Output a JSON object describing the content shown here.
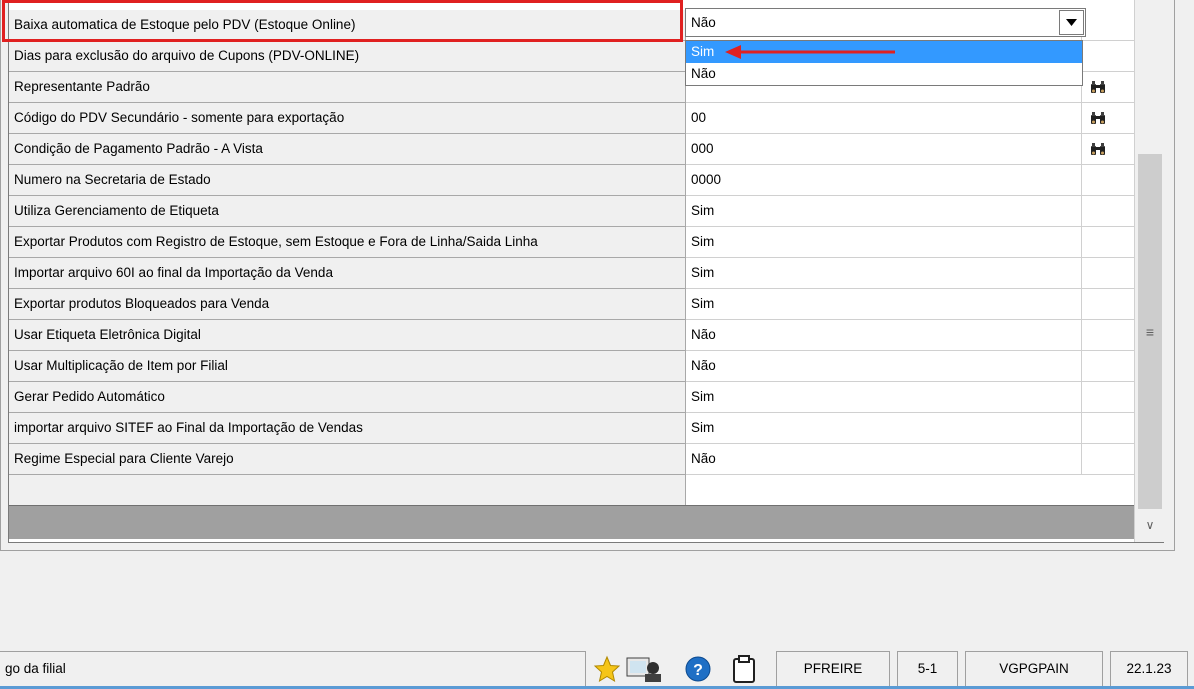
{
  "grid": {
    "rows": [
      {
        "label": "Baixa automatica de Estoque pelo PDV (Estoque Online)",
        "value": "",
        "lookup": false
      },
      {
        "label": "Dias para exclusão do arquivo de Cupons (PDV-ONLINE)",
        "value": "",
        "lookup": false
      },
      {
        "label": "Representante Padrão",
        "value": "",
        "lookup": true
      },
      {
        "label": "Código do PDV Secundário - somente para exportação",
        "value": "00",
        "lookup": true
      },
      {
        "label": "Condição de Pagamento Padrão - A Vista",
        "value": "000",
        "lookup": true
      },
      {
        "label": "Numero na Secretaria de Estado",
        "value": "0000",
        "lookup": false
      },
      {
        "label": "Utiliza Gerenciamento de Etiqueta",
        "value": "Sim",
        "lookup": false
      },
      {
        "label": "Exportar Produtos com Registro de Estoque, sem Estoque e Fora de Linha/Saida Linha",
        "value": "Sim",
        "lookup": false
      },
      {
        "label": "Importar arquivo 60I ao final da Importação da Venda",
        "value": "Sim",
        "lookup": false
      },
      {
        "label": "Exportar produtos Bloqueados para Venda",
        "value": "Sim",
        "lookup": false
      },
      {
        "label": "Usar Etiqueta Eletrônica Digital",
        "value": "Não",
        "lookup": false
      },
      {
        "label": "Usar Multiplicação de Item por Filial",
        "value": "Não",
        "lookup": false
      },
      {
        "label": "Gerar Pedido Automático",
        "value": "Sim",
        "lookup": false
      },
      {
        "label": "importar arquivo SITEF ao Final da Importação de Vendas",
        "value": "Sim",
        "lookup": false
      },
      {
        "label": "Regime Especial para Cliente Varejo",
        "value": "Não",
        "lookup": false
      }
    ]
  },
  "combo": {
    "selected": "Não",
    "options": [
      "Sim",
      "Não"
    ],
    "highlighted_option": "Sim"
  },
  "statusbar": {
    "hint": "go da filial",
    "user": "PFREIRE",
    "code": "5-1",
    "module": "VGPGPAIN",
    "version": "22.1.23"
  },
  "colors": {
    "annotation": "#e02020",
    "selection": "#3399ff"
  },
  "icons": [
    "binoculars-icon",
    "star-icon",
    "computer-user-icon",
    "help-icon",
    "clipboard-icon",
    "combo-arrow-icon",
    "scroll-down-icon",
    "grip-icon"
  ]
}
